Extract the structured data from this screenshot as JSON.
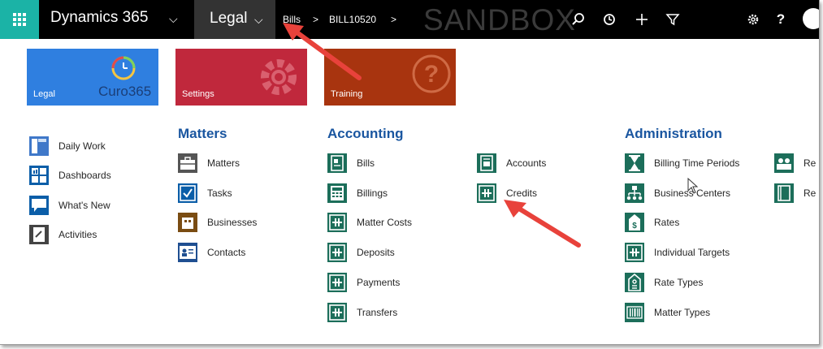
{
  "topbar": {
    "app_name": "Dynamics 365",
    "area": "Legal",
    "crumb_entity": "Bills",
    "crumb_sep1": ">",
    "crumb_record": "BILL10520",
    "crumb_sep2": ">",
    "environment": "SANDBOX",
    "chevron": "⌵"
  },
  "tiles": {
    "legal": "Legal",
    "legal_logo": "Curo365",
    "settings": "Settings",
    "training": "Training"
  },
  "left_nav": [
    {
      "label": "Daily Work",
      "icon": "daily-work-icon"
    },
    {
      "label": "Dashboards",
      "icon": "dashboards-icon"
    },
    {
      "label": "What's New",
      "icon": "whats-new-icon"
    },
    {
      "label": "Activities",
      "icon": "activities-icon"
    }
  ],
  "matters": {
    "title": "Matters",
    "items": [
      {
        "label": "Matters",
        "icon": "briefcase-icon"
      },
      {
        "label": "Tasks",
        "icon": "task-check-icon"
      },
      {
        "label": "Businesses",
        "icon": "business-icon"
      },
      {
        "label": "Contacts",
        "icon": "contact-card-icon"
      }
    ]
  },
  "accounting": {
    "title": "Accounting",
    "col1": [
      {
        "label": "Bills",
        "icon": "bill-doc-icon"
      },
      {
        "label": "Billings",
        "icon": "calculator-icon"
      },
      {
        "label": "Matter Costs",
        "icon": "ledger-icon"
      },
      {
        "label": "Deposits",
        "icon": "ledger-icon"
      },
      {
        "label": "Payments",
        "icon": "ledger-icon"
      },
      {
        "label": "Transfers",
        "icon": "ledger-icon"
      }
    ],
    "col2": [
      {
        "label": "Accounts",
        "icon": "accounts-doc-icon"
      },
      {
        "label": "Credits",
        "icon": "ledger-icon"
      }
    ]
  },
  "administration": {
    "title": "Administration",
    "col1": [
      {
        "label": "Billing Time Periods",
        "icon": "hourglass-icon"
      },
      {
        "label": "Business Centers",
        "icon": "org-chart-icon"
      },
      {
        "label": "Rates",
        "icon": "rate-tag-icon"
      },
      {
        "label": "Individual Targets",
        "icon": "ledger-icon"
      },
      {
        "label": "Rate Types",
        "icon": "rate-type-icon"
      },
      {
        "label": "Matter Types",
        "icon": "barcode-icon"
      }
    ],
    "col2": [
      {
        "label": "Re",
        "icon": "people-icon"
      },
      {
        "label": "Re",
        "icon": "notebook-icon"
      }
    ]
  },
  "colors": {
    "waffle": "#1bb3a6",
    "legal_tile": "#2f7fe0",
    "settings_tile": "#c0283c",
    "training_tile": "#a8340f",
    "section_title": "#1a56a0",
    "icon_green": "#1c6e5a",
    "arrow": "#e8423b"
  }
}
